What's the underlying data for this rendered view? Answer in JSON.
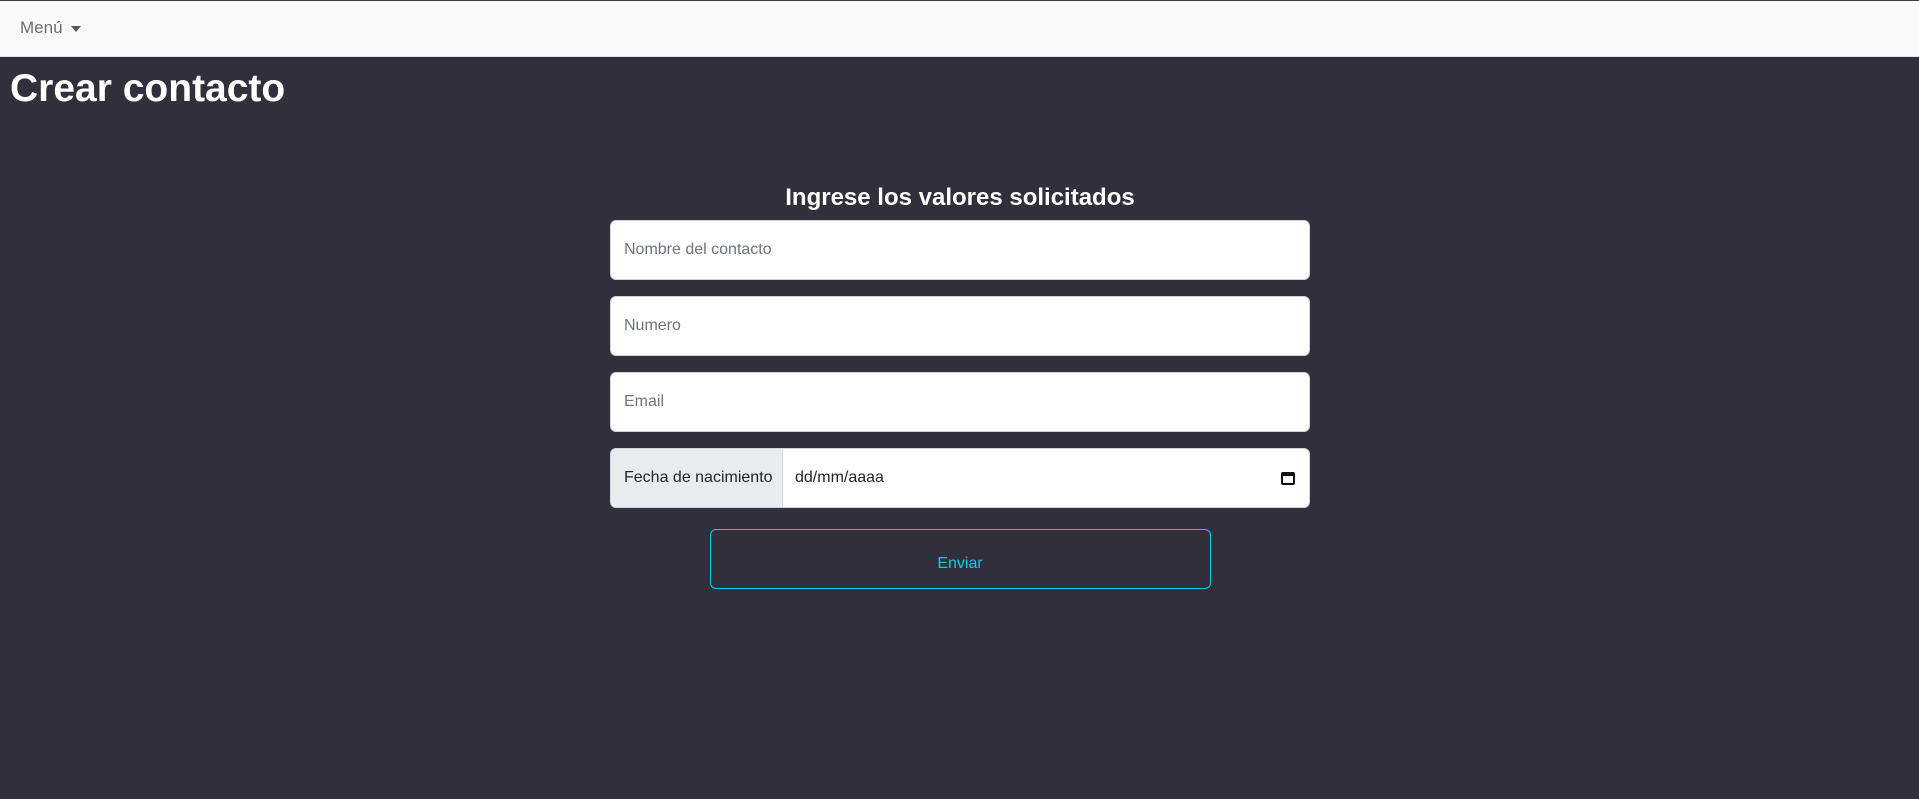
{
  "navbar": {
    "menu_label": "Menú",
    "menu_icon": "caret-down-icon"
  },
  "page": {
    "title": "Crear contacto"
  },
  "form": {
    "heading": "Ingrese los valores solicitados",
    "name_placeholder": "Nombre del contacto",
    "number_placeholder": "Numero",
    "email_placeholder": "Email",
    "birthdate_label": "Fecha de nacimiento",
    "birthdate_value": "dd/mm/aaaa",
    "birthdate_icon": "calendar-icon",
    "submit_label": "Enviar"
  },
  "colors": {
    "background": "#322f3d",
    "navbar": "#f8f9fa",
    "submit_accent": "#0dcaf0"
  }
}
